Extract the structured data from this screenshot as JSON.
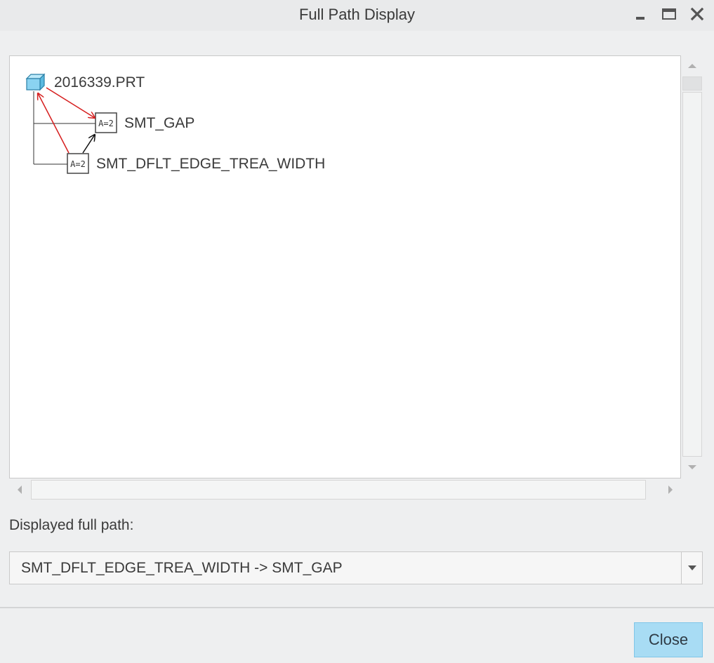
{
  "window": {
    "title": "Full Path Display"
  },
  "tree": {
    "nodes": [
      {
        "label": "2016339.PRT",
        "icon": "part-icon"
      },
      {
        "label": "SMT_GAP",
        "icon": "parameter-icon"
      },
      {
        "label": "SMT_DFLT_EDGE_TREA_WIDTH",
        "icon": "parameter-icon"
      }
    ],
    "param_icon_text": "A=2"
  },
  "path": {
    "label": "Displayed full path:",
    "value": "SMT_DFLT_EDGE_TREA_WIDTH -> SMT_GAP"
  },
  "footer": {
    "close_label": "Close"
  },
  "colors": {
    "accent_button": "#a8dcf4",
    "path_arrow_red": "#d61f1f",
    "path_arrow_black": "#111111"
  }
}
